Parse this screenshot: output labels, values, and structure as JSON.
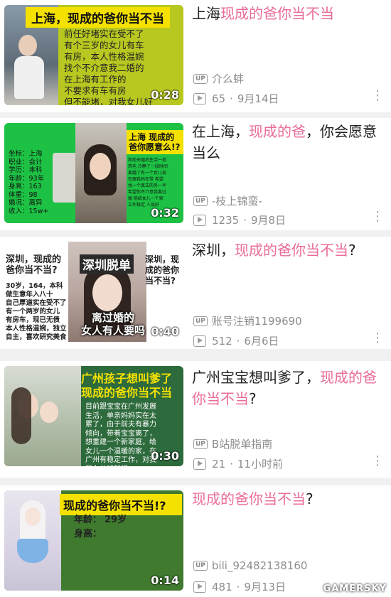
{
  "videos": [
    {
      "title_prefix": "上海",
      "title_highlight": "现成的爸你当不当",
      "title_suffix": "",
      "duration": "0:28",
      "up_label": "UP",
      "uploader": "介么蚌",
      "views": "65",
      "date": "9月14日",
      "thumb_banner": "上海，现成的爸你当不当",
      "thumb_text": "前任好堵实在受不了\n有个三岁的女儿有车\n有房，本人性格温婉\n找个不介意我二婚的\n在上海有工作的\n不要求有车有房\n但不能堵，对我女儿好"
    },
    {
      "title_prefix": "在上海，",
      "title_highlight": "现成的爸",
      "title_suffix": "，你会愿意当么",
      "duration": "0:32",
      "up_label": "UP",
      "uploader": "-枝上锦蛮-",
      "views": "1235",
      "date": "9月8日",
      "thumb_banner": "上海 现成的爸你愿意么!?",
      "thumb_left": "坐标：上海\n职业：会计\n学历：本科\n年龄：93年\n身高：163\n体重：98\n婚况：离异\n收入：15w+",
      "thumb_right": "和前夫婚后生活一地\n鸡毛 冷静了一段时间\n离婚了有一个女儿现\n在跟我妈在带 希望\n找一个真正的另一半\n希望你不介意我离过\n婚 能给女儿一个家\n工作稳定 人品好"
    },
    {
      "title_prefix": "深圳，",
      "title_highlight": "现成的爸你当不当",
      "title_suffix": "?",
      "duration": "0:40",
      "up_label": "UP",
      "uploader": "账号注销1199690",
      "views": "512",
      "date": "6月6日",
      "thumb_left_top": "深圳，现成的爸你当不当?",
      "thumb_center_top": "深圳脱单",
      "thumb_right_top": "深圳，现成的爸你当不当?",
      "thumb_left_text": "30岁，164，本科\n做生意年入八十\n自己厚道实在受不了\n有一个两岁的女儿\n有房车，现已无债\n本人性格温婉，独立\n自主，喜欢研究美食",
      "thumb_center_bottom": "离过婚的\n女人有人要吗"
    },
    {
      "title_prefix": "广州宝宝想叫爹了，",
      "title_highlight": "现成的爸你当不当",
      "title_suffix": "?",
      "duration": "0:30",
      "up_label": "UP",
      "uploader": "B站脱单指南",
      "views": "21",
      "date": "11小时前",
      "thumb_banner": "广州孩子想叫爹了\n现成的爸你当不当",
      "thumb_text": "目前跟宝宝在广州发展\n生活，单亲妈妈实在太\n累了，由于前夫有暴力\n倾向，带着宝宝离了，\n想重建一个新家庭，给\n女儿一个温暖的家，在\n广州有稳定工作，对我\n和女儿好就行。"
    },
    {
      "title_prefix": "",
      "title_highlight": "现成的爸你当不当",
      "title_suffix": "?",
      "duration": "0:14",
      "up_label": "UP",
      "uploader": "bili_92482138160",
      "views": "481",
      "date": "9月13日",
      "thumb_banner": "现成的爸你当不当!?",
      "thumb_age_label": "年龄：",
      "thumb_age": "29岁",
      "thumb_height_label": "身高："
    }
  ],
  "dot_separator": "·",
  "more_icon": "⋮",
  "watermark": "GAMERSKY"
}
